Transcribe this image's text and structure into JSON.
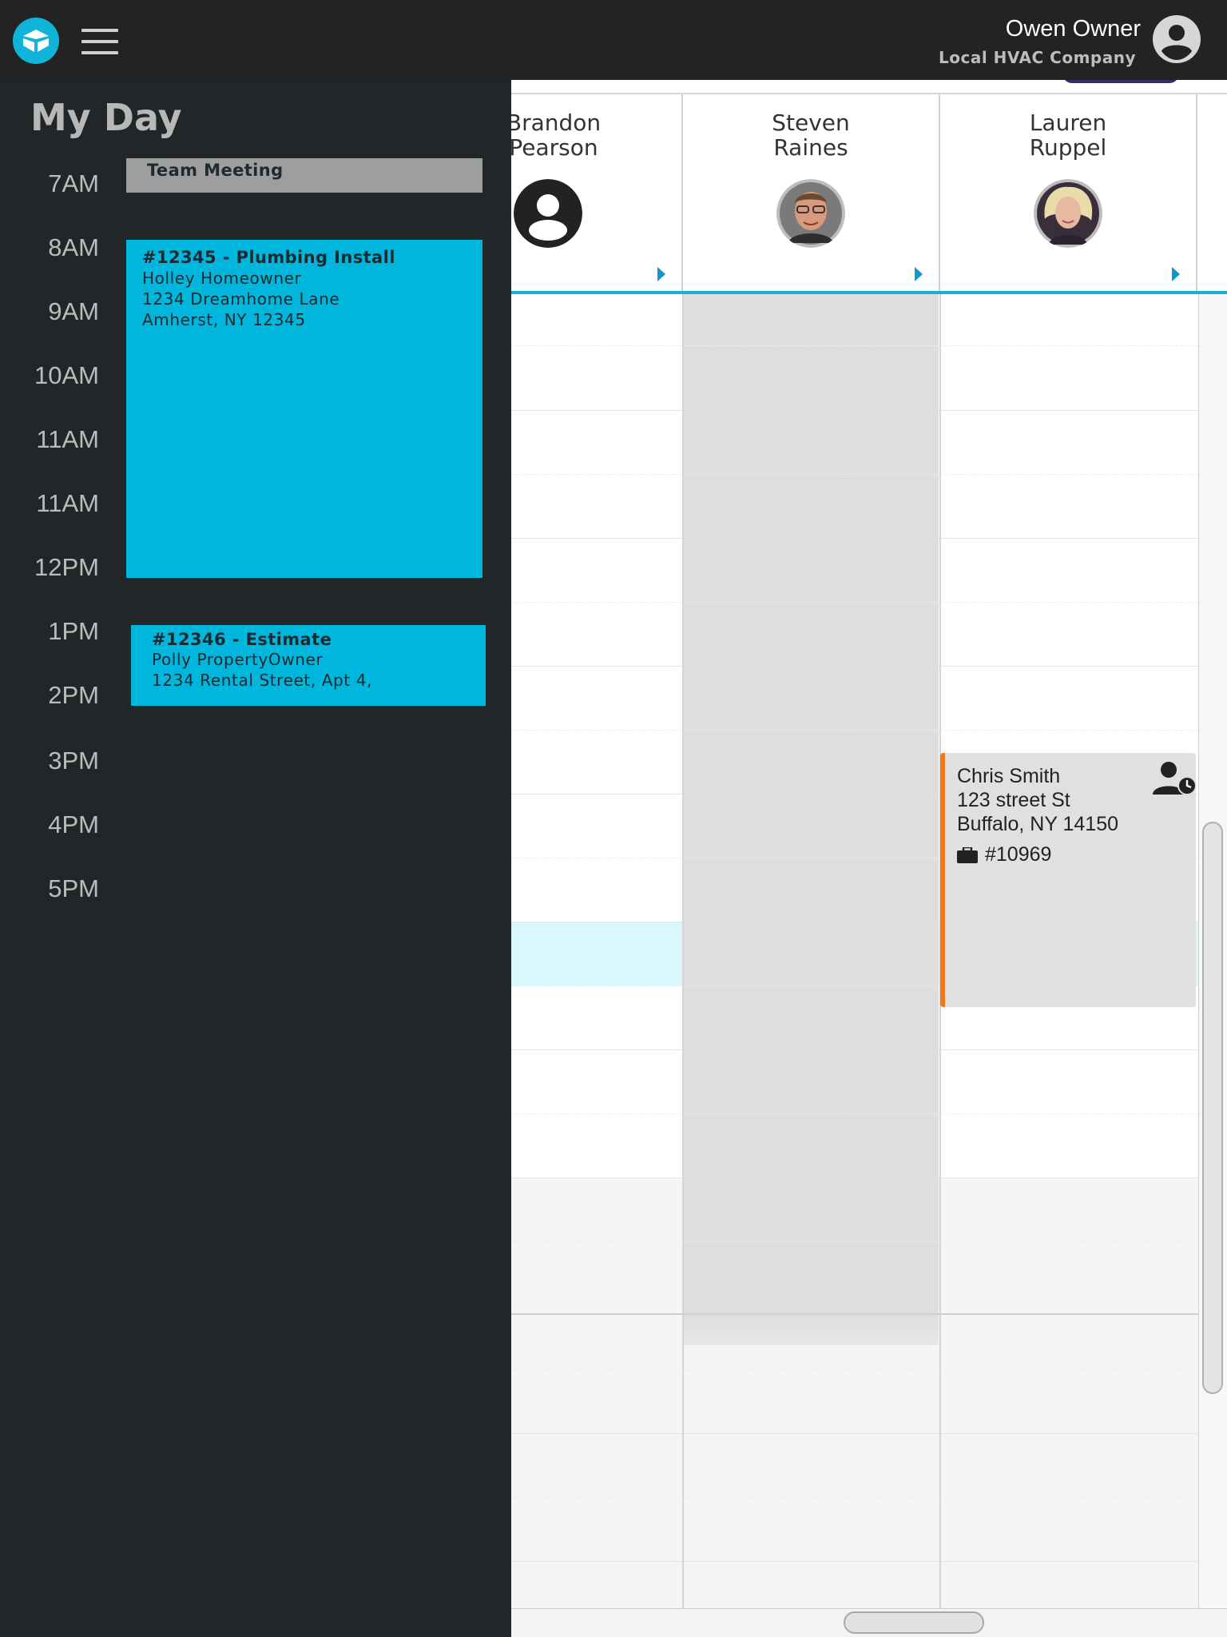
{
  "header": {
    "user_name": "Owen Owner",
    "company": "Local HVAC Company",
    "logo_icon": "brand-logo-icon",
    "menu_icon": "hamburger-menu-icon",
    "account_icon": "account-circle-icon"
  },
  "my_day": {
    "title": "My Day",
    "times": [
      "7AM",
      "8AM",
      "9AM",
      "10AM",
      "11AM",
      "11AM",
      "12PM",
      "1PM",
      "2PM",
      "3PM",
      "4PM",
      "5PM"
    ],
    "events": {
      "meeting": {
        "title": "Team Meeting"
      },
      "install": {
        "title": "#12345  - Plumbing Install",
        "name": "Holley Homeowner",
        "address": "1234 Dreamhome Lane",
        "city": "Amherst, NY 12345"
      },
      "estimate": {
        "title": "#12346 - Estimate",
        "name": "Polly PropertyOwner",
        "address": "1234 Rental Street, Apt 4,"
      }
    }
  },
  "schedule": {
    "technicians": [
      {
        "name": "Brandon\nPearson",
        "avatar": "default-user-icon"
      },
      {
        "name": "Steven\nRaines",
        "avatar": "photo"
      },
      {
        "name": "Lauren\nRuppel",
        "avatar": "photo"
      }
    ],
    "appointment": {
      "name": "Chris Smith",
      "street": "123 street St",
      "city": "Buffalo, NY 14150",
      "job": "#10969",
      "job_icon": "briefcase-icon",
      "status_icon": "person-clock-icon"
    },
    "colors": {
      "accent": "#00b6dc",
      "appointment_border": "#f07a18",
      "current_hour_band": "#d9f7fc",
      "unavailable": "#dedede"
    }
  }
}
